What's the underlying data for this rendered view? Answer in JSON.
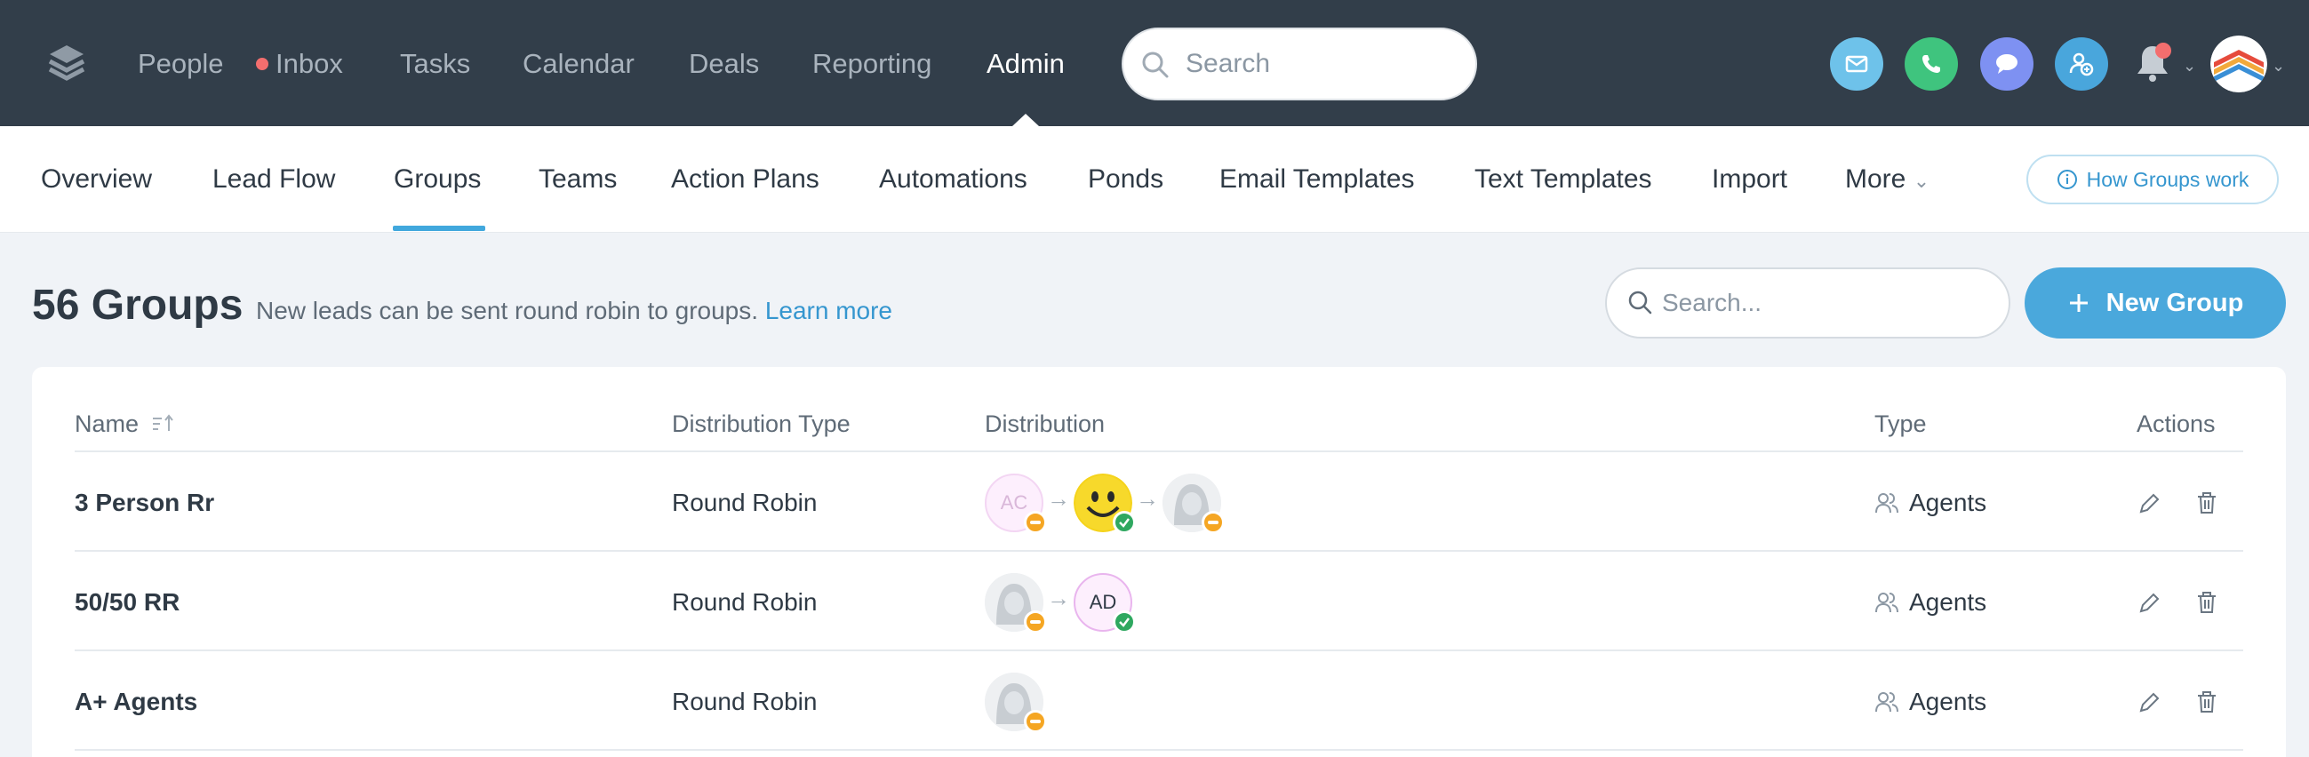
{
  "topnav": {
    "items": [
      {
        "label": "People"
      },
      {
        "label": "Inbox"
      },
      {
        "label": "Tasks"
      },
      {
        "label": "Calendar"
      },
      {
        "label": "Deals"
      },
      {
        "label": "Reporting"
      },
      {
        "label": "Admin"
      }
    ],
    "active": "Admin",
    "search_placeholder": "Search",
    "icons": [
      "email-icon",
      "phone-icon",
      "chat-icon",
      "add-contact-icon",
      "bell-icon",
      "user-avatar"
    ],
    "colors": {
      "bar": "#323e4a",
      "email": "#6ec2ea",
      "phone": "#3fc47e",
      "chat": "#7e91f2",
      "add_contact": "#49a6dc",
      "notification_dot": "#f36e6e"
    }
  },
  "subnav": {
    "items": [
      {
        "label": "Overview"
      },
      {
        "label": "Lead Flow"
      },
      {
        "label": "Groups"
      },
      {
        "label": "Teams"
      },
      {
        "label": "Action Plans"
      },
      {
        "label": "Automations"
      },
      {
        "label": "Ponds"
      },
      {
        "label": "Email Templates"
      },
      {
        "label": "Text Templates"
      },
      {
        "label": "Import"
      },
      {
        "label": "More"
      }
    ],
    "active": "Groups",
    "help_button": "How Groups work",
    "accent": "#41a8dd"
  },
  "header": {
    "title": "56 Groups",
    "subtitle": "New leads can be sent round robin to groups.",
    "learn_more": "Learn more",
    "search_placeholder": "Search...",
    "new_button": "New Group"
  },
  "table": {
    "columns": {
      "name": "Name",
      "distribution_type": "Distribution Type",
      "distribution": "Distribution",
      "type": "Type",
      "actions": "Actions"
    },
    "rows": [
      {
        "name": "3 Person Rr",
        "distribution_type": "Round Robin",
        "distribution": [
          {
            "kind": "initials",
            "initials": "AC",
            "status": "away"
          },
          {
            "kind": "smiley",
            "status": "available"
          },
          {
            "kind": "placeholder",
            "status": "away"
          }
        ],
        "type": "Agents"
      },
      {
        "name": "50/50 RR",
        "distribution_type": "Round Robin",
        "distribution": [
          {
            "kind": "placeholder",
            "status": "away"
          },
          {
            "kind": "initials",
            "initials": "AD",
            "status": "available"
          }
        ],
        "type": "Agents"
      },
      {
        "name": "A+ Agents",
        "distribution_type": "Round Robin",
        "distribution": [
          {
            "kind": "placeholder",
            "status": "away"
          }
        ],
        "type": "Agents"
      }
    ],
    "status_colors": {
      "away": "#f5a623",
      "available": "#2fa860"
    }
  }
}
